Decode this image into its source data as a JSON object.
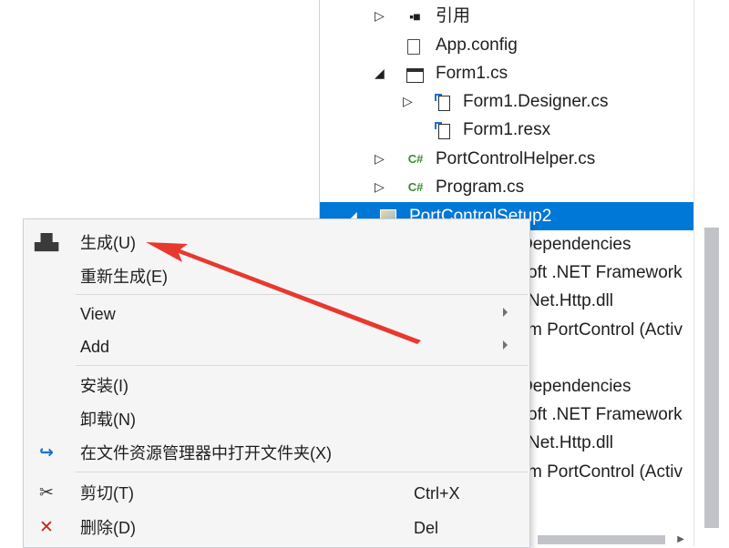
{
  "solution_explorer": {
    "items": [
      {
        "label": "引用",
        "icon": "references-icon",
        "expander": "collapsed"
      },
      {
        "label": "App.config",
        "icon": "config-file-icon",
        "expander": "none"
      },
      {
        "label": "Form1.cs",
        "icon": "form-icon",
        "expander": "expanded"
      },
      {
        "label": "Form1.Designer.cs",
        "icon": "designer-file-icon",
        "expander": "collapsed"
      },
      {
        "label": "Form1.resx",
        "icon": "resx-file-icon",
        "expander": "none"
      },
      {
        "label": "PortControlHelper.cs",
        "icon": "csharp-file-icon",
        "expander": "collapsed"
      },
      {
        "label": "Program.cs",
        "icon": "csharp-file-icon",
        "expander": "collapsed"
      },
      {
        "label": "PortControlSetup2",
        "icon": "setup-project-icon",
        "expander": "expanded",
        "selected": true
      },
      {
        "label": "Dependencies",
        "icon": "",
        "expander": "none"
      },
      {
        "label": "oft .NET Framework",
        "icon": "",
        "expander": "none"
      },
      {
        "label": "Net.Http.dll",
        "icon": "",
        "expander": "none"
      },
      {
        "label": "m PortControl (Activ",
        "icon": "",
        "expander": "none"
      },
      {
        "label": "Dependencies",
        "icon": "",
        "expander": "none"
      },
      {
        "label": "oft .NET Framework",
        "icon": "",
        "expander": "none"
      },
      {
        "label": "Net.Http.dll",
        "icon": "",
        "expander": "none"
      },
      {
        "label": "m PortControl (Activ",
        "icon": "",
        "expander": "none"
      }
    ]
  },
  "context_menu": {
    "build": {
      "label": "生成(U)",
      "icon": "build-icon"
    },
    "rebuild": {
      "label": "重新生成(E)"
    },
    "view": {
      "label": "View",
      "has_submenu": true
    },
    "add": {
      "label": "Add",
      "has_submenu": true
    },
    "install": {
      "label": "安装(I)"
    },
    "uninstall": {
      "label": "卸载(N)"
    },
    "open_folder": {
      "label": "在文件资源管理器中打开文件夹(X)",
      "icon": "open-folder-arrow-icon"
    },
    "cut": {
      "label": "剪切(T)",
      "shortcut": "Ctrl+X",
      "icon": "scissors-icon"
    },
    "delete": {
      "label": "删除(D)",
      "shortcut": "Del",
      "icon": "delete-x-icon"
    }
  },
  "annotation": {
    "color": "#e8392f"
  },
  "colors": {
    "selection": "#0078d7",
    "menu_background": "#f5f5f5",
    "csharp_icon": "#3b8a2e"
  }
}
